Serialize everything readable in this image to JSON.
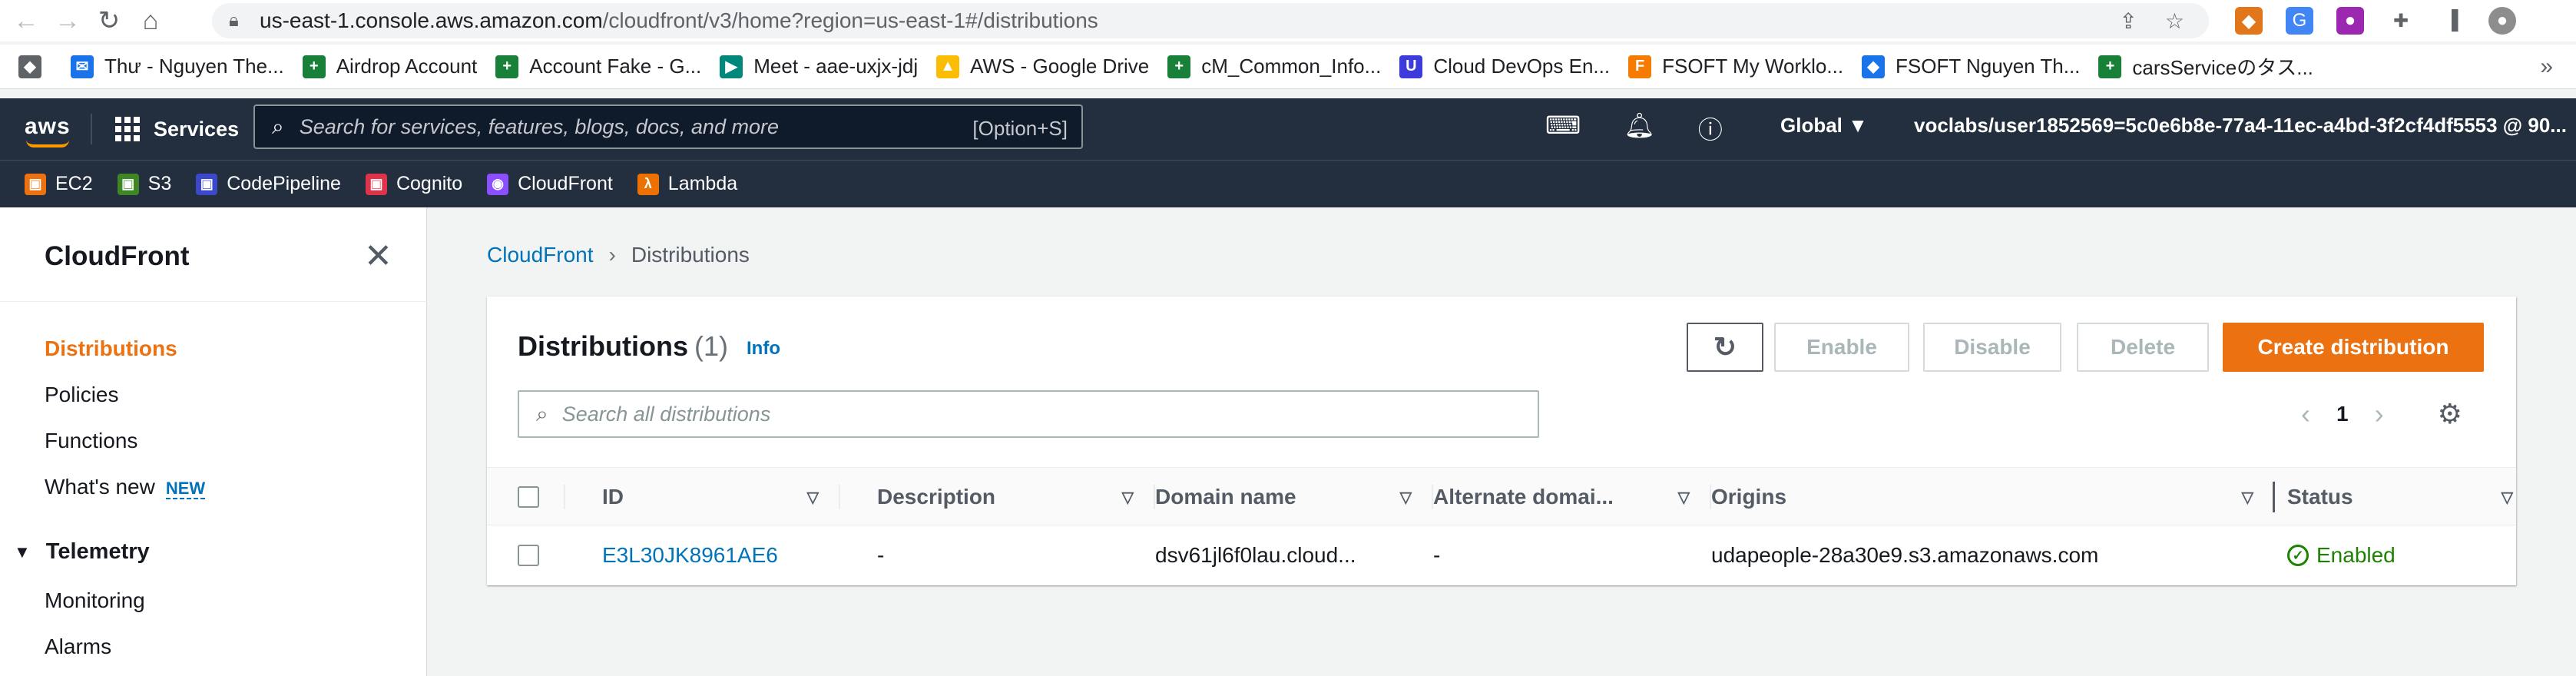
{
  "browser": {
    "url_host": "us-east-1.console.aws.amazon.com",
    "url_path": "/cloudfront/v3/home?region=us-east-1#/distributions"
  },
  "bookmarks": [
    {
      "label": "Thư - Nguyen The...",
      "color": "#1a73e8"
    },
    {
      "label": "Airdrop Account",
      "color": "#188038"
    },
    {
      "label": "Account Fake - G...",
      "color": "#188038"
    },
    {
      "label": "Meet - aae-uxjx-jdj",
      "color": "#00897b"
    },
    {
      "label": "AWS - Google Drive",
      "color": "#fbbc04"
    },
    {
      "label": "cM_Common_Info...",
      "color": "#188038"
    },
    {
      "label": "Cloud DevOps En...",
      "color": "#3c3cdc"
    },
    {
      "label": "FSOFT My Worklo...",
      "color": "#f57c00"
    },
    {
      "label": "FSOFT Nguyen Th...",
      "color": "#1a73e8"
    },
    {
      "label": "carsServiceのタス...",
      "color": "#188038"
    }
  ],
  "aws_nav": {
    "logo": "aws",
    "services": "Services",
    "search_placeholder": "Search for services, features, blogs, docs, and more",
    "search_shortcut": "[Option+S]",
    "region": "Global ▼",
    "account": "voclabs/user1852569=5c0e6b8e-77a4-11ec-a4bd-3f2cf4df5553 @ 90... ▼"
  },
  "favorites": [
    {
      "label": "EC2",
      "color": "#ec7211"
    },
    {
      "label": "S3",
      "color": "#3f8624"
    },
    {
      "label": "CodePipeline",
      "color": "#3b48cc"
    },
    {
      "label": "Cognito",
      "color": "#dd344c"
    },
    {
      "label": "CloudFront",
      "color": "#8c4fff"
    },
    {
      "label": "Lambda",
      "color": "#ed7100"
    }
  ],
  "sidenav": {
    "title": "CloudFront",
    "items": {
      "distributions": "Distributions",
      "policies": "Policies",
      "functions": "Functions",
      "whats_new": "What's new",
      "new_badge": "NEW"
    },
    "telemetry": "Telemetry",
    "telemetry_items": {
      "monitoring": "Monitoring",
      "alarms": "Alarms"
    }
  },
  "breadcrumb": {
    "root": "CloudFront",
    "current": "Distributions"
  },
  "panel": {
    "title": "Distributions",
    "count": "(1)",
    "info": "Info",
    "buttons": {
      "enable": "Enable",
      "disable": "Disable",
      "delete": "Delete",
      "create": "Create distribution"
    },
    "search_placeholder": "Search all distributions",
    "page": "1"
  },
  "table": {
    "columns": {
      "id": "ID",
      "description": "Description",
      "domain": "Domain name",
      "alternate": "Alternate domai...",
      "origins": "Origins",
      "status": "Status"
    },
    "row": {
      "id": "E3L30JK8961AE6",
      "description": "-",
      "domain": "dsv61jl6f0lau.cloud...",
      "alternate": "-",
      "origins": "udapeople-28a30e9.s3.amazonaws.com",
      "status": "Enabled"
    }
  },
  "colors": {
    "aws_nav_bg": "#232f3e",
    "accent_orange": "#ec7211",
    "link_blue": "#0073bb",
    "status_green": "#1d8102"
  }
}
